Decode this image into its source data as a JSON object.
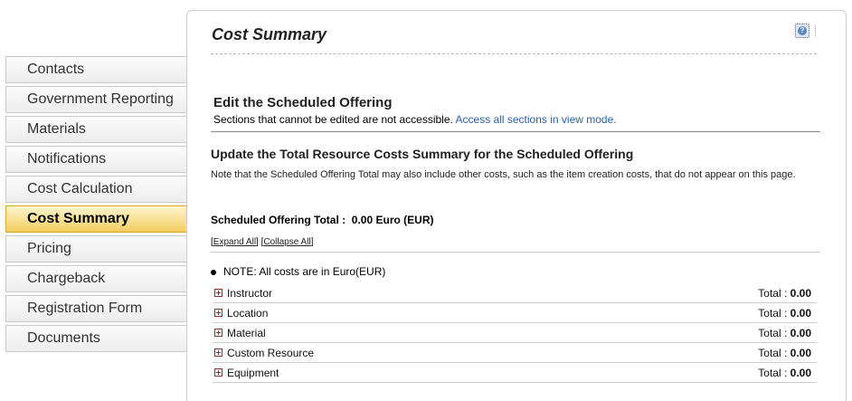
{
  "sidebar": {
    "items": [
      {
        "label": "Contacts"
      },
      {
        "label": "Government Reporting"
      },
      {
        "label": "Materials"
      },
      {
        "label": "Notifications"
      },
      {
        "label": "Cost Calculation"
      },
      {
        "label": "Cost Summary",
        "active": true
      },
      {
        "label": "Pricing"
      },
      {
        "label": "Chargeback"
      },
      {
        "label": "Registration Form"
      },
      {
        "label": "Documents"
      }
    ]
  },
  "header": {
    "title": "Cost Summary",
    "help_icon": "help-icon"
  },
  "edit": {
    "title": "Edit the Scheduled Offering",
    "desc": "Sections that cannot be edited are not accessible.",
    "link": "Access all sections in view mode."
  },
  "update": {
    "title": "Update the Total Resource Costs Summary for the Scheduled Offering",
    "note": "Note that the Scheduled Offering Total may also include other costs, such as the item creation costs, that do not appear on this page.",
    "total_label": "Scheduled Offering Total :",
    "total_value": "0.00 Euro (EUR)",
    "expand_all": "Expand All",
    "collapse_all": "Collapse All",
    "bullet_note": "NOTE: All costs are in Euro(EUR)"
  },
  "costs": [
    {
      "name": "Instructor",
      "total_label": "Total :",
      "total": "0.00"
    },
    {
      "name": "Location",
      "total_label": "Total :",
      "total": "0.00"
    },
    {
      "name": "Material",
      "total_label": "Total :",
      "total": "0.00"
    },
    {
      "name": "Custom Resource",
      "total_label": "Total :",
      "total": "0.00"
    },
    {
      "name": "Equipment",
      "total_label": "Total :",
      "total": "0.00"
    }
  ],
  "colors": {
    "active_tab": "#f2cd60",
    "link": "#2a63a8",
    "expand_icon": "#9a2b2b"
  }
}
